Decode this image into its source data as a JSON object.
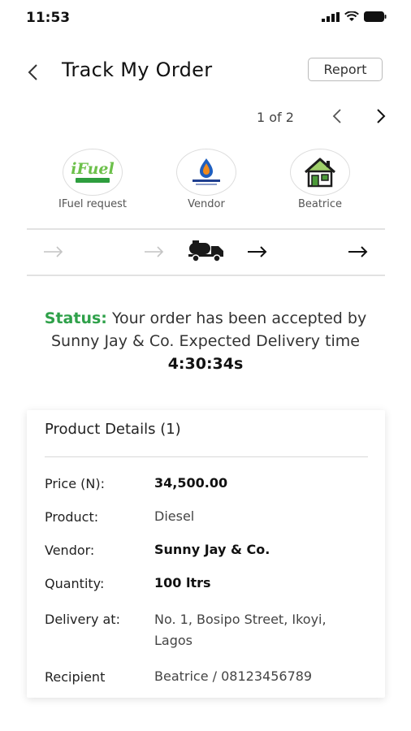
{
  "status_bar": {
    "time": "11:53"
  },
  "header": {
    "title": "Track My Order",
    "report_label": "Report"
  },
  "pager": {
    "text": "1 of 2"
  },
  "stages": [
    {
      "label": "IFuel request",
      "logo_text": "iFuel"
    },
    {
      "label": "Vendor"
    },
    {
      "label": "Beatrice"
    }
  ],
  "progress": {
    "active_step": 3,
    "total_steps": 5
  },
  "status": {
    "label": "Status:",
    "message": "Your order has been accepted by Sunny Jay & Co. Expected Delivery time",
    "eta": "4:30:34s"
  },
  "product": {
    "title": "Product Details (1)",
    "rows": [
      {
        "label": "Price (N):",
        "value": "34,500.00"
      },
      {
        "label": "Product:",
        "value": "Diesel"
      },
      {
        "label": "Vendor:",
        "value": "Sunny Jay & Co."
      },
      {
        "label": "Quantity:",
        "value": "100 ltrs"
      },
      {
        "label": "Delivery at:",
        "value": "No. 1, Bosipo Street, Ikoyi, Lagos"
      },
      {
        "label": "Recipient",
        "value": "Beatrice / 08123456789"
      }
    ]
  },
  "colors": {
    "accent_green": "#2fa14a",
    "ifuel_green": "#6cc04a"
  }
}
